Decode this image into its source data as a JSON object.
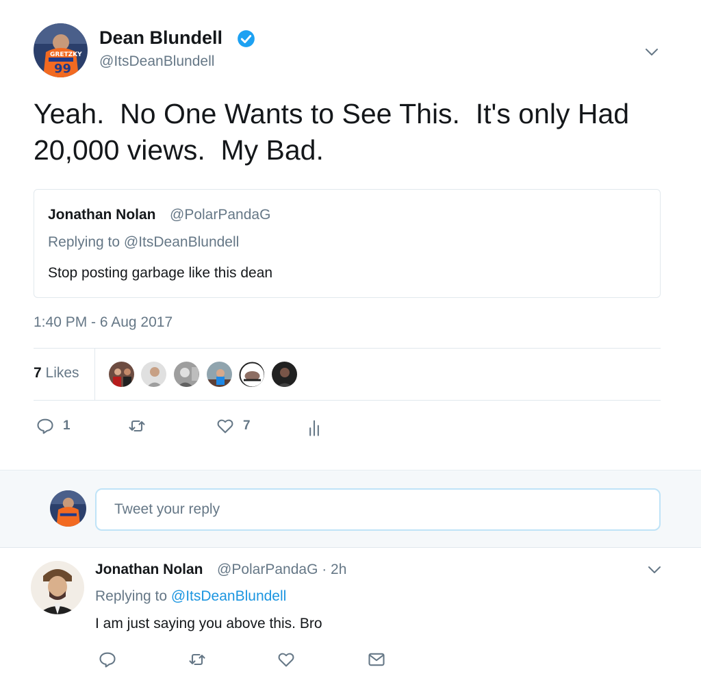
{
  "tweet": {
    "author_name": "Dean Blundell",
    "author_handle": "@ItsDeanBlundell",
    "text": "Yeah.  No One Wants to See This.  It's only Had 20,000 views.  My Bad.",
    "timestamp": "1:40 PM - 6 Aug 2017",
    "quoted": {
      "author_name": "Jonathan Nolan",
      "author_handle": "@PolarPandaG",
      "replying_to": "Replying to @ItsDeanBlundell",
      "text": "Stop posting garbage like this dean"
    },
    "likes": {
      "count": "7",
      "label": "Likes"
    },
    "actions": {
      "reply_count": "1",
      "like_count": "7"
    }
  },
  "reply_box": {
    "placeholder": "Tweet your reply"
  },
  "reply_tweet": {
    "author_name": "Jonathan Nolan",
    "author_handle": "@PolarPandaG · 2h",
    "replying_label": "Replying to",
    "replying_handle": "@ItsDeanBlundell",
    "text": "I am just saying you above this. Bro"
  },
  "colors": {
    "accent": "#1b95e0",
    "muted": "#657786",
    "text": "#14171a",
    "verified": "#1da1f2",
    "divider": "#e1e8ed",
    "reply_bar_bg": "#f5f8fa"
  },
  "icons": {
    "verified": "verified-badge-icon",
    "caret": "chevron-down-icon",
    "reply": "reply-icon",
    "retweet": "retweet-icon",
    "like": "heart-icon",
    "analytics": "analytics-icon",
    "message": "envelope-icon"
  }
}
